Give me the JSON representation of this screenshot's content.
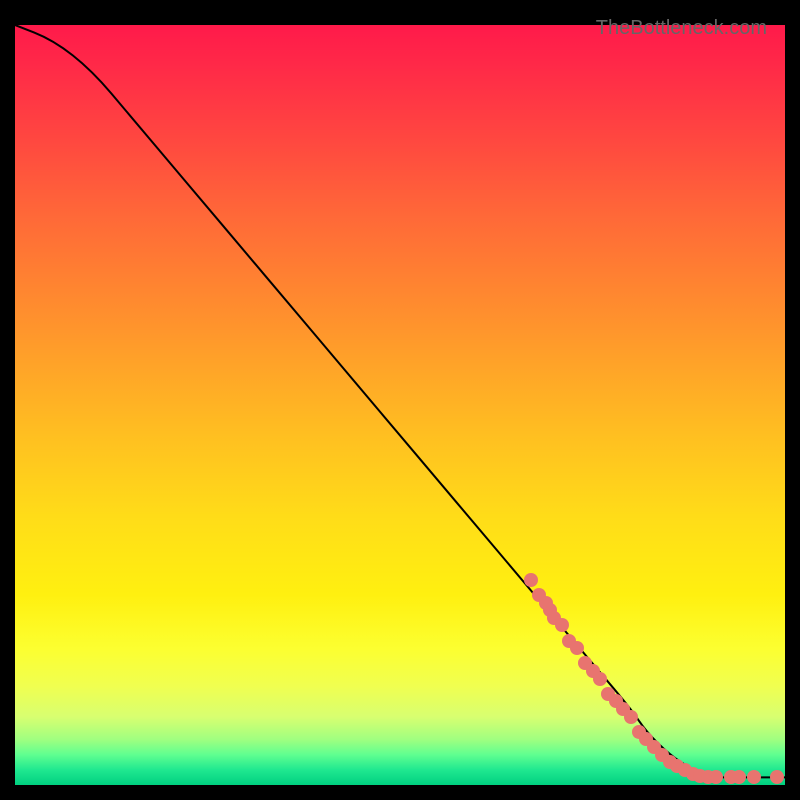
{
  "attribution": "TheBottleneck.com",
  "chart_data": {
    "type": "line",
    "title": "",
    "xlabel": "",
    "ylabel": "",
    "xlim": [
      0,
      100
    ],
    "ylim": [
      0,
      100
    ],
    "background_gradient": {
      "top": "#ff1a4a",
      "middle": "#ffdd18",
      "bottom": "#00d080"
    },
    "series": [
      {
        "name": "bottleneck-curve",
        "x": [
          0,
          5,
          10,
          15,
          20,
          25,
          30,
          35,
          40,
          45,
          50,
          55,
          60,
          65,
          70,
          75,
          80,
          82,
          85,
          88,
          90,
          92,
          94,
          96,
          98,
          100
        ],
        "y": [
          100,
          98,
          94,
          88,
          82,
          76,
          70,
          64,
          58,
          52,
          46,
          40,
          34,
          28,
          22,
          16,
          10,
          7,
          4,
          2,
          1,
          1,
          1,
          1,
          1,
          1
        ]
      }
    ],
    "scatter_points": {
      "name": "data-points",
      "color": "#e8746f",
      "points": [
        {
          "x": 67,
          "y": 27
        },
        {
          "x": 68,
          "y": 25
        },
        {
          "x": 69,
          "y": 24
        },
        {
          "x": 69.5,
          "y": 23
        },
        {
          "x": 70,
          "y": 22
        },
        {
          "x": 71,
          "y": 21
        },
        {
          "x": 72,
          "y": 19
        },
        {
          "x": 73,
          "y": 18
        },
        {
          "x": 74,
          "y": 16
        },
        {
          "x": 75,
          "y": 15
        },
        {
          "x": 76,
          "y": 14
        },
        {
          "x": 77,
          "y": 12
        },
        {
          "x": 78,
          "y": 11
        },
        {
          "x": 79,
          "y": 10
        },
        {
          "x": 80,
          "y": 9
        },
        {
          "x": 81,
          "y": 7
        },
        {
          "x": 82,
          "y": 6
        },
        {
          "x": 83,
          "y": 5
        },
        {
          "x": 84,
          "y": 4
        },
        {
          "x": 85,
          "y": 3
        },
        {
          "x": 86,
          "y": 2.5
        },
        {
          "x": 87,
          "y": 2
        },
        {
          "x": 88,
          "y": 1.5
        },
        {
          "x": 89,
          "y": 1.2
        },
        {
          "x": 90,
          "y": 1
        },
        {
          "x": 91,
          "y": 1
        },
        {
          "x": 93,
          "y": 1
        },
        {
          "x": 94,
          "y": 1
        },
        {
          "x": 96,
          "y": 1
        },
        {
          "x": 99,
          "y": 1
        }
      ]
    }
  }
}
